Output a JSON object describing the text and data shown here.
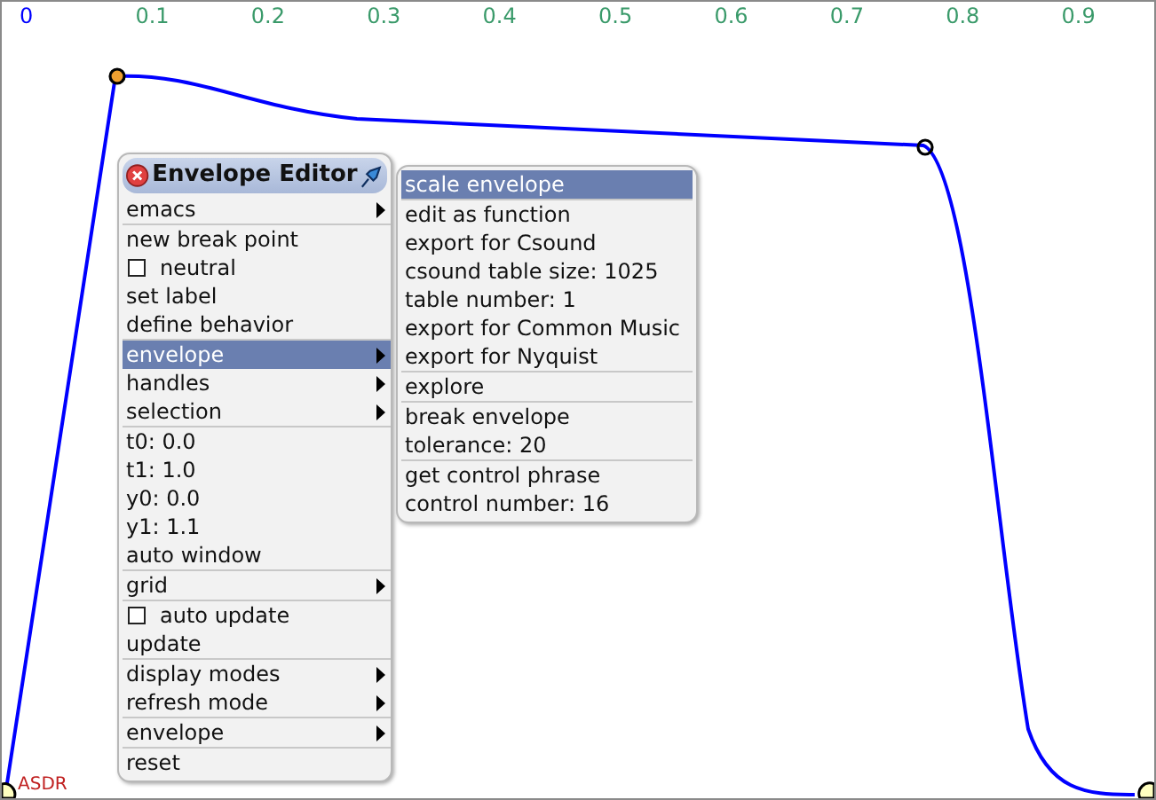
{
  "ruler": [
    {
      "text": "0",
      "kind": "origin"
    },
    {
      "text": "0.1",
      "kind": "tick"
    },
    {
      "text": "0.2",
      "kind": "tick"
    },
    {
      "text": "0.3",
      "kind": "tick"
    },
    {
      "text": "0.4",
      "kind": "tick"
    },
    {
      "text": "0.5",
      "kind": "tick"
    },
    {
      "text": "0.6",
      "kind": "tick"
    },
    {
      "text": "0.7",
      "kind": "tick"
    },
    {
      "text": "0.8",
      "kind": "tick"
    },
    {
      "text": "0.9",
      "kind": "tick"
    }
  ],
  "breakpoints": [
    {
      "selected": true
    },
    {
      "selected": false
    }
  ],
  "envelope_label": "ASDR",
  "menu": {
    "title": "Envelope Editor",
    "groups": [
      [
        {
          "label": "emacs",
          "kind": "submenu",
          "selected": false
        }
      ],
      [
        {
          "label": "new break point",
          "kind": "action",
          "selected": false
        },
        {
          "label": "neutral",
          "kind": "checkbox",
          "checked": false,
          "selected": false
        },
        {
          "label": "set label",
          "kind": "action",
          "selected": false
        },
        {
          "label": "define behavior",
          "kind": "action",
          "selected": false
        }
      ],
      [
        {
          "label": "envelope",
          "kind": "submenu",
          "selected": true
        },
        {
          "label": "handles",
          "kind": "submenu",
          "selected": false
        },
        {
          "label": "selection",
          "kind": "submenu",
          "selected": false
        }
      ],
      [
        {
          "label": "t0: 0.0",
          "kind": "action",
          "selected": false
        },
        {
          "label": "t1: 1.0",
          "kind": "action",
          "selected": false
        },
        {
          "label": "y0: 0.0",
          "kind": "action",
          "selected": false
        },
        {
          "label": "y1: 1.1",
          "kind": "action",
          "selected": false
        },
        {
          "label": "auto window",
          "kind": "action",
          "selected": false
        }
      ],
      [
        {
          "label": "grid",
          "kind": "submenu",
          "selected": false
        }
      ],
      [
        {
          "label": "auto update",
          "kind": "checkbox",
          "checked": false,
          "selected": false
        },
        {
          "label": "update",
          "kind": "action",
          "selected": false
        }
      ],
      [
        {
          "label": "display modes",
          "kind": "submenu",
          "selected": false
        },
        {
          "label": "refresh mode",
          "kind": "submenu",
          "selected": false
        }
      ],
      [
        {
          "label": "envelope",
          "kind": "submenu",
          "selected": false
        }
      ],
      [
        {
          "label": "reset",
          "kind": "action",
          "selected": false
        }
      ]
    ]
  },
  "submenu": {
    "groups": [
      [
        {
          "label": "scale envelope",
          "selected": true
        }
      ],
      [
        {
          "label": "edit as function",
          "selected": false
        },
        {
          "label": "export for Csound",
          "selected": false
        },
        {
          "label": "csound table size: 1025",
          "selected": false
        },
        {
          "label": "table number: 1",
          "selected": false
        },
        {
          "label": "export for Common Music",
          "selected": false
        },
        {
          "label": "export for Nyquist",
          "selected": false
        }
      ],
      [
        {
          "label": "explore",
          "selected": false
        }
      ],
      [
        {
          "label": "break envelope",
          "selected": false
        },
        {
          "label": "tolerance: 20",
          "selected": false
        }
      ],
      [
        {
          "label": "get control phrase",
          "selected": false
        },
        {
          "label": "control number: 16",
          "selected": false
        }
      ]
    ]
  }
}
